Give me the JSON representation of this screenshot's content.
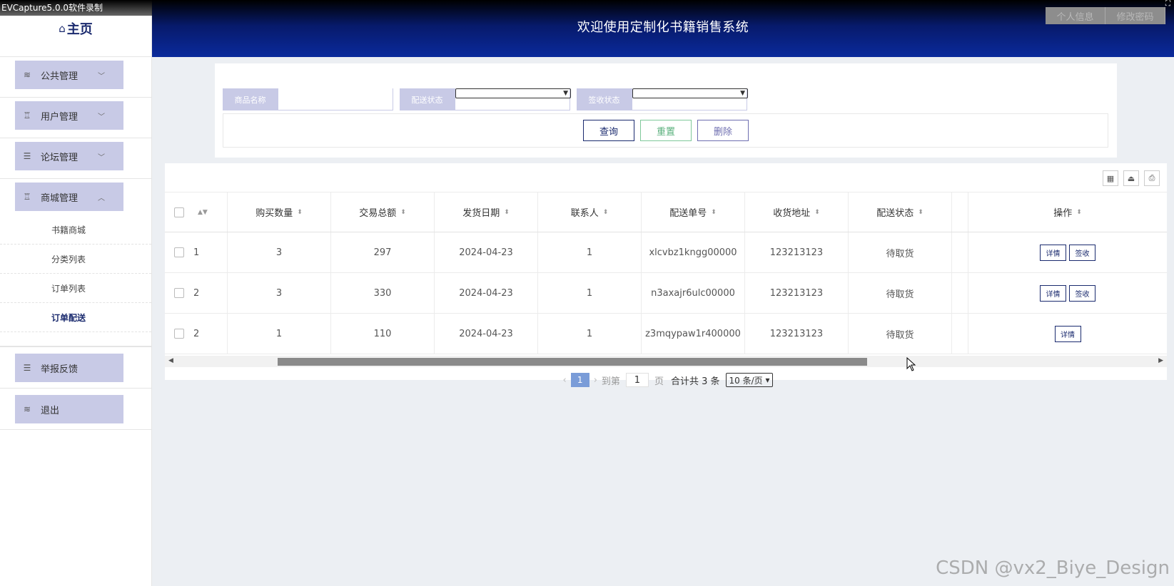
{
  "watermark": "EVCapture5.0.0软件录制",
  "sidebar": {
    "home_label": "主页",
    "menu": [
      {
        "label": "公共管理",
        "icon": "layers-icon",
        "chevron": "﹀"
      },
      {
        "label": "用户管理",
        "icon": "alarm-icon",
        "chevron": "﹀"
      },
      {
        "label": "论坛管理",
        "icon": "list-icon",
        "chevron": "﹀"
      },
      {
        "label": "商城管理",
        "icon": "alarm-icon",
        "chevron": "︿"
      },
      {
        "label": "举报反馈",
        "icon": "list-icon",
        "chevron": ""
      },
      {
        "label": "退出",
        "icon": "layers-icon",
        "chevron": ""
      }
    ],
    "submenu": [
      "书籍商城",
      "分类列表",
      "订单列表",
      "订单配送"
    ],
    "active_submenu": "订单配送"
  },
  "header": {
    "title": "欢迎使用定制化书籍销售系统",
    "buttons": [
      "个人信息",
      "修改密码"
    ]
  },
  "search": {
    "fields": [
      {
        "label": "商品名称",
        "type": "text",
        "value": ""
      },
      {
        "label": "配送状态",
        "type": "select",
        "value": ""
      },
      {
        "label": "签收状态",
        "type": "select",
        "value": ""
      }
    ],
    "buttons": {
      "search": "查询",
      "reset": "重置",
      "delete": "删除"
    }
  },
  "table": {
    "columns": [
      "购买数量",
      "交易总额",
      "发货日期",
      "联系人",
      "配送单号",
      "收货地址",
      "配送状态"
    ],
    "op_column": "操作",
    "rows": [
      {
        "prev": "1",
        "cells": [
          "3",
          "297",
          "2024-04-23",
          "1",
          "xlcvbz1kngg00000",
          "123213123",
          "待取货"
        ],
        "actions": [
          "详情",
          "签收"
        ]
      },
      {
        "prev": "2",
        "cells": [
          "3",
          "330",
          "2024-04-23",
          "1",
          "n3axajr6ulc00000",
          "123213123",
          "待取货"
        ],
        "actions": [
          "详情",
          "签收"
        ]
      },
      {
        "prev": "2",
        "cells": [
          "1",
          "110",
          "2024-04-23",
          "1",
          "z3mqypaw1r400000",
          "123213123",
          "待取货"
        ],
        "actions": [
          "详情"
        ]
      }
    ]
  },
  "pager": {
    "current": "1",
    "goto_label": "到第",
    "goto_value": "1",
    "page_unit": "页",
    "total_text": "合计共 3 条",
    "page_size": "10 条/页"
  },
  "corner_watermark": "CSDN @vx2_Biye_Design"
}
